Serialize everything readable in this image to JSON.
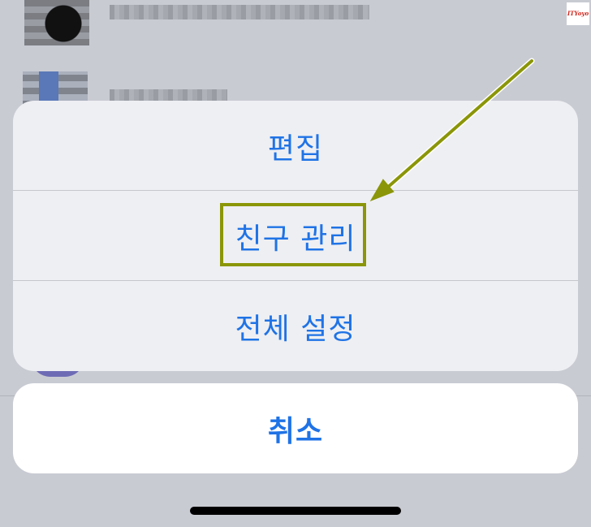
{
  "watermark": "ITYoyo",
  "action_sheet": {
    "items": [
      {
        "label": "편집"
      },
      {
        "label": "친구 관리"
      },
      {
        "label": "전체 설정"
      }
    ],
    "cancel_label": "취소"
  },
  "colors": {
    "action_text": "#1f73e6",
    "sheet_background": "#eeeff3",
    "cancel_background": "#ffffff",
    "annotation": "#8b9608"
  },
  "annotation": {
    "highlighted_item": "친구 관리"
  }
}
